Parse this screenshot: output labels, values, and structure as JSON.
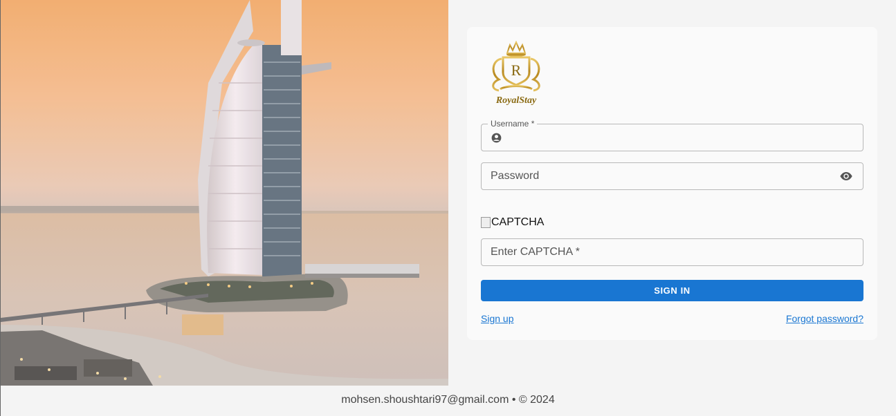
{
  "brand": {
    "logo_text": "RoyalStay",
    "logo_letter": "R"
  },
  "form": {
    "username": {
      "label": "Username *",
      "value": ""
    },
    "password": {
      "placeholder": "Password",
      "value": ""
    },
    "captcha": {
      "alt_text": "CAPTCHA",
      "placeholder": "Enter CAPTCHA *",
      "value": ""
    },
    "submit_label": "SIGN IN"
  },
  "links": {
    "signup": "Sign up",
    "forgot": "Forgot password?"
  },
  "footer": {
    "text": "mohsen.shoushtari97@gmail.com • © 2024"
  },
  "colors": {
    "primary": "#1976d2",
    "gold": "#b8891f",
    "page_bg": "#f4f4f4",
    "card_bg": "#fafafa"
  },
  "icons": {
    "username": "account-circle-icon",
    "password": "visibility-eye-icon"
  }
}
